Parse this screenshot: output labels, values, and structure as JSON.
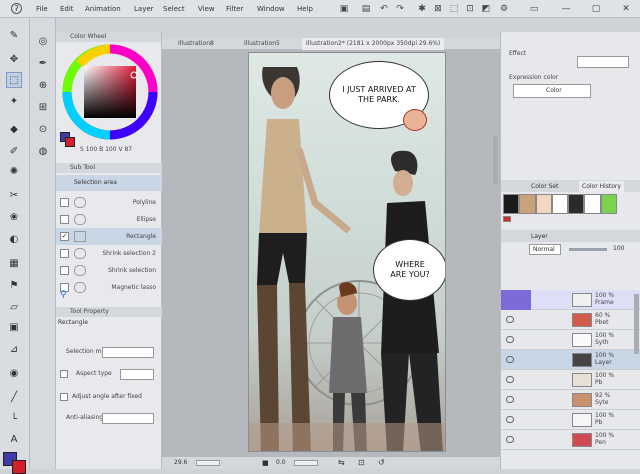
{
  "menubar": {
    "items": [
      "File",
      "Edit",
      "Animation",
      "Layer",
      "Select",
      "View",
      "Filter",
      "Window",
      "Help"
    ]
  },
  "color_wheel": {
    "title": "Color Wheel",
    "values": "S 100 B 100 V 87"
  },
  "sub_tool": {
    "title": "Sub Tool",
    "tab_label": "Selection area",
    "items": [
      "Polyline",
      "Ellipse",
      "Rectangle",
      "Shrink selection 2",
      "Shrink selection",
      "Magnetic lasso"
    ],
    "selected": "Rectangle"
  },
  "tool_property": {
    "title": "Tool Property",
    "subtitle": "Rectangle",
    "rows": [
      "Selection m.",
      "Aspect type",
      "Adjust angle after fixed",
      "Anti-aliasing"
    ]
  },
  "tabs": [
    {
      "label": "Illustration8"
    },
    {
      "label": "Illustration5"
    },
    {
      "label": "Illustration2* (2181 x 2000px 350dpi 29.6%)"
    }
  ],
  "speech": {
    "bubble1": "I JUST ARRIVED AT THE PARK.",
    "bubble2": "WHERE ARE YOU?"
  },
  "statusbar": {
    "zoom": "29.6",
    "angle": "0.0"
  },
  "right_panel": {
    "effect_label": "Effect",
    "expression_label": "Expression color",
    "expression_value": "Color",
    "color_set_tab": "Color Set",
    "color_history_tab": "Color History",
    "layer_tab": "Layer",
    "blend_mode": "Normal",
    "opacity": "100"
  },
  "palette": [
    "#1a1a1a",
    "#c9a27c",
    "#f3d7c0",
    "#ffffff",
    "#2b2b2b",
    "#ffffff",
    "#7ad24f",
    "#cf2d2d"
  ],
  "layers": [
    {
      "pct": "100 %",
      "name": "Frame"
    },
    {
      "pct": "60 %",
      "name": "Pbet"
    },
    {
      "pct": "100 %",
      "name": "Syth"
    },
    {
      "pct": "100 %",
      "name": "Layer"
    },
    {
      "pct": "100 %",
      "name": "Pb"
    },
    {
      "pct": "92 %",
      "name": "Syte"
    },
    {
      "pct": "100 %",
      "name": "Pb"
    },
    {
      "pct": "100 %",
      "name": "Pen"
    }
  ],
  "colors": {
    "accent_blue": "#2f6bd1",
    "main_color": "#3e3aa8",
    "sub_color": "#d21f2b"
  }
}
